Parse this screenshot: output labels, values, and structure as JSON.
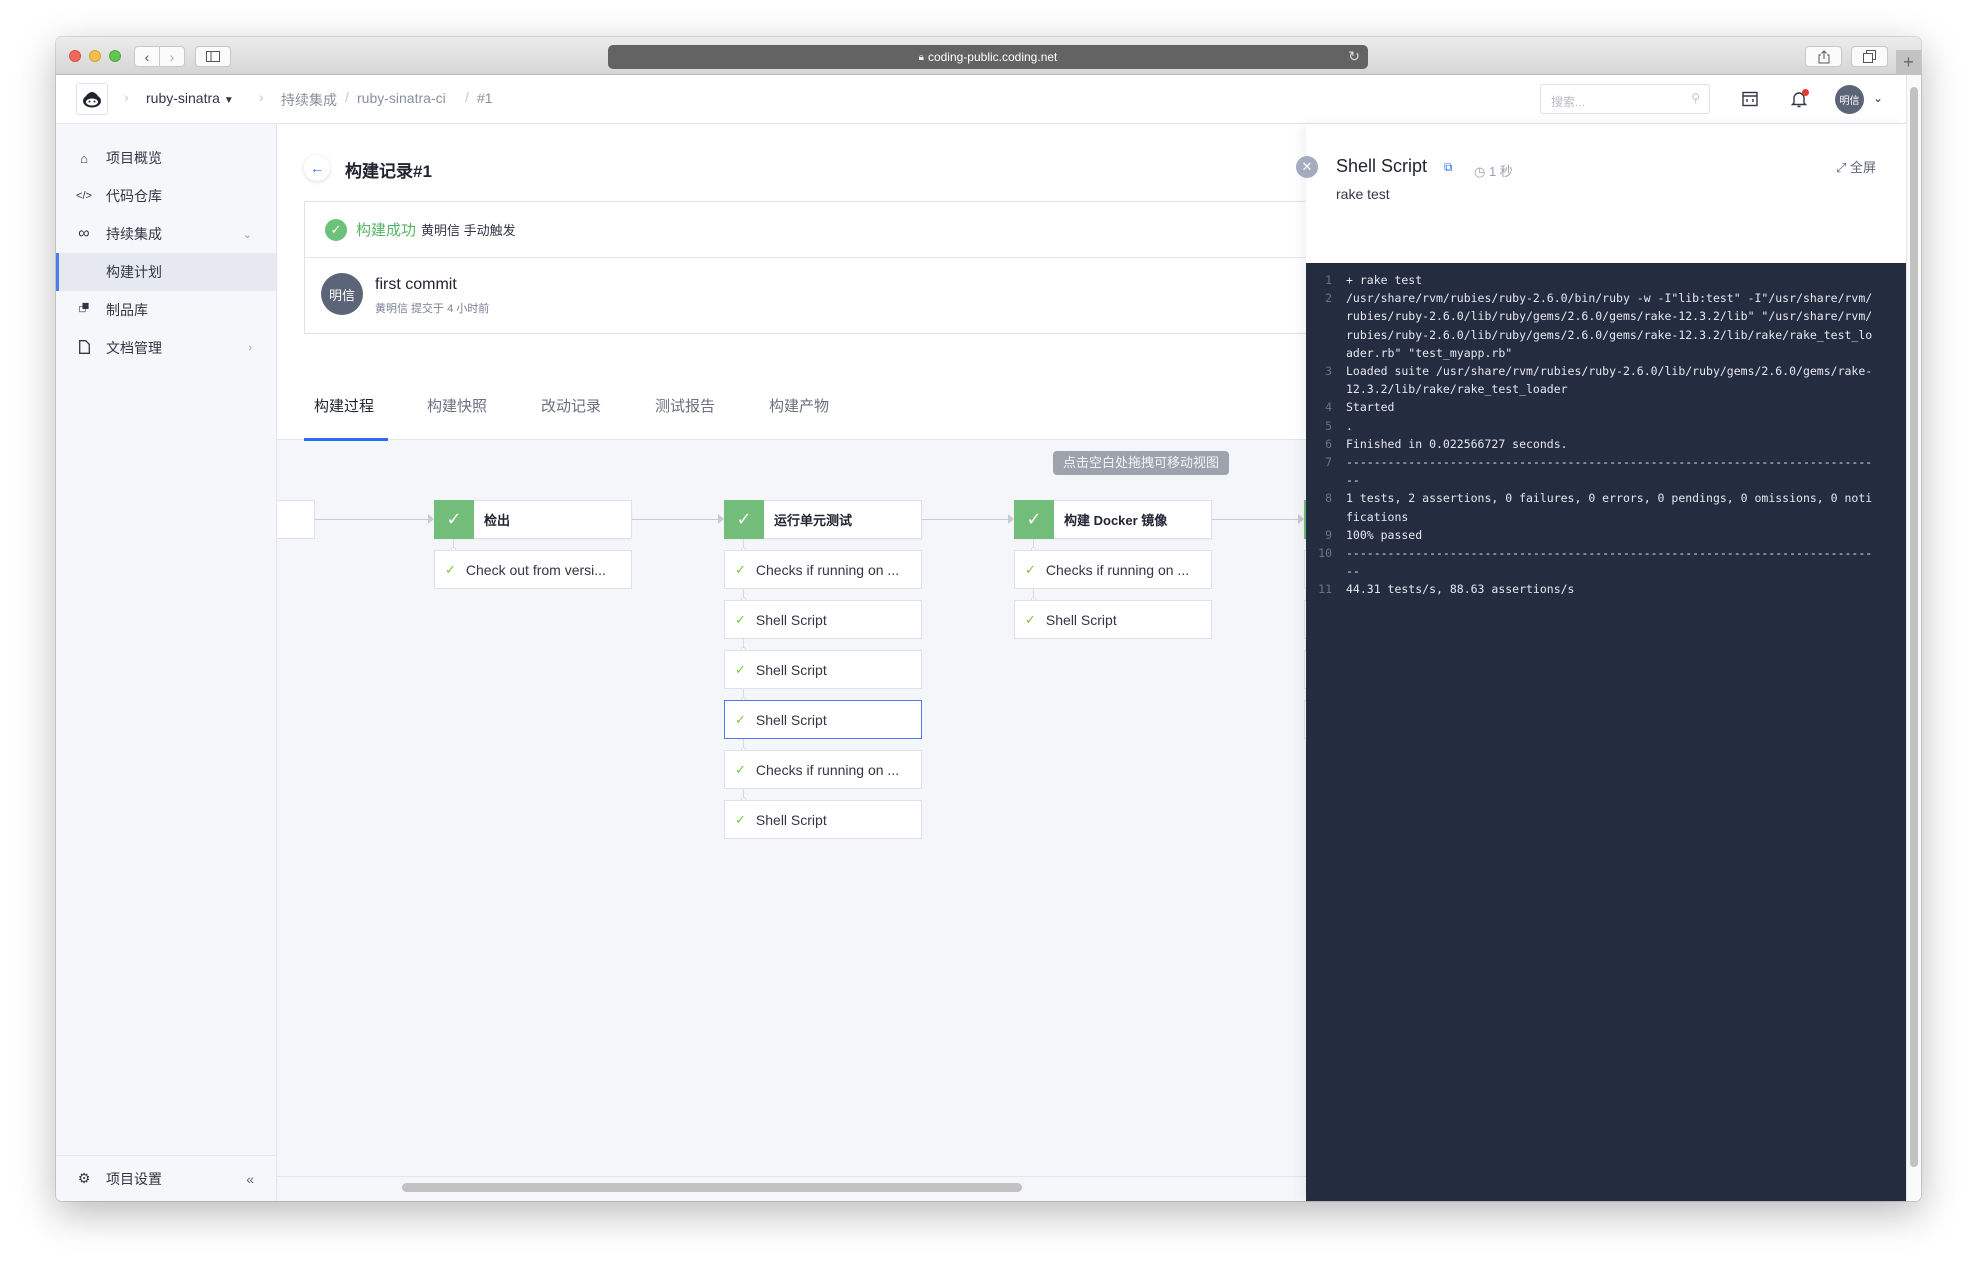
{
  "browser": {
    "url": "coding-public.coding.net",
    "lock_icon": "lock-icon",
    "reload_icon": "reload-icon"
  },
  "header": {
    "project": "ruby-sinatra",
    "breadcrumbs": [
      "持续集成",
      "ruby-sinatra-ci",
      "#1"
    ],
    "search_placeholder": "搜索...",
    "user_avatar": "明信"
  },
  "sidebar": {
    "items": [
      {
        "label": "项目概览",
        "icon": "home-icon"
      },
      {
        "label": "代码仓库",
        "icon": "code-icon"
      },
      {
        "label": "持续集成",
        "icon": "infinity-icon",
        "expanded": true
      },
      {
        "label": "构建计划",
        "active": true
      },
      {
        "label": "制品库",
        "icon": "package-icon"
      },
      {
        "label": "文档管理",
        "icon": "document-icon"
      }
    ],
    "settings_label": "项目设置"
  },
  "main": {
    "title": "构建记录#1",
    "status": {
      "label": "构建成功",
      "meta": "黄明信 手动触发"
    },
    "commit": {
      "avatar": "明信",
      "title": "first commit",
      "meta": "黄明信 提交于 4 小时前"
    },
    "tabs": [
      {
        "label": "构建过程",
        "active": true
      },
      {
        "label": "构建快照"
      },
      {
        "label": "改动记录"
      },
      {
        "label": "测试报告"
      },
      {
        "label": "构建产物"
      }
    ],
    "hint": "点击空白处拖拽可移动视图",
    "stages": [
      {
        "name": "检出",
        "steps": [
          "Check out from versi..."
        ]
      },
      {
        "name": "运行单元测试",
        "steps": [
          "Checks if running on ...",
          "Shell Script",
          "Shell Script",
          "Shell Script",
          "Checks if running on ...",
          "Shell Script"
        ],
        "selected_step": 3
      },
      {
        "name": "构建 Docker 镜像",
        "steps": [
          "Checks if running on ...",
          "Shell Script"
        ]
      },
      {
        "name": "",
        "steps": [
          "",
          "",
          "",
          ""
        ]
      }
    ]
  },
  "panel": {
    "title": "Shell Script",
    "duration": "1 秒",
    "subtitle": "rake test",
    "fullscreen_label": "全屏",
    "log": [
      {
        "no": "1",
        "text": "+ rake test"
      },
      {
        "no": "2",
        "text": "/usr/share/rvm/rubies/ruby-2.6.0/bin/ruby -w -I\"lib:test\" -I\"/usr/share/rvm/rubies/ruby-2.6.0/lib/ruby/gems/2.6.0/gems/rake-12.3.2/lib\" \"/usr/share/rvm/rubies/ruby-2.6.0/lib/ruby/gems/2.6.0/gems/rake-12.3.2/lib/rake/rake_test_loader.rb\" \"test_myapp.rb\""
      },
      {
        "no": "3",
        "text": "Loaded suite /usr/share/rvm/rubies/ruby-2.6.0/lib/ruby/gems/2.6.0/gems/rake-12.3.2/lib/rake/rake_test_loader"
      },
      {
        "no": "4",
        "text": "Started"
      },
      {
        "no": "5",
        "text": "."
      },
      {
        "no": "6",
        "text": "Finished in 0.022566727 seconds."
      },
      {
        "no": "7",
        "text": "------------------------------------------------------------------------------"
      },
      {
        "no": "8",
        "text": "1 tests, 2 assertions, 0 failures, 0 errors, 0 pendings, 0 omissions, 0 notifications"
      },
      {
        "no": "9",
        "text": "100% passed"
      },
      {
        "no": "10",
        "text": "------------------------------------------------------------------------------"
      },
      {
        "no": "11",
        "text": "44.31 tests/s, 88.63 assertions/s"
      }
    ]
  },
  "colors": {
    "accent": "#2e6cf6",
    "success": "#72bd79",
    "log_bg": "#242c40"
  }
}
